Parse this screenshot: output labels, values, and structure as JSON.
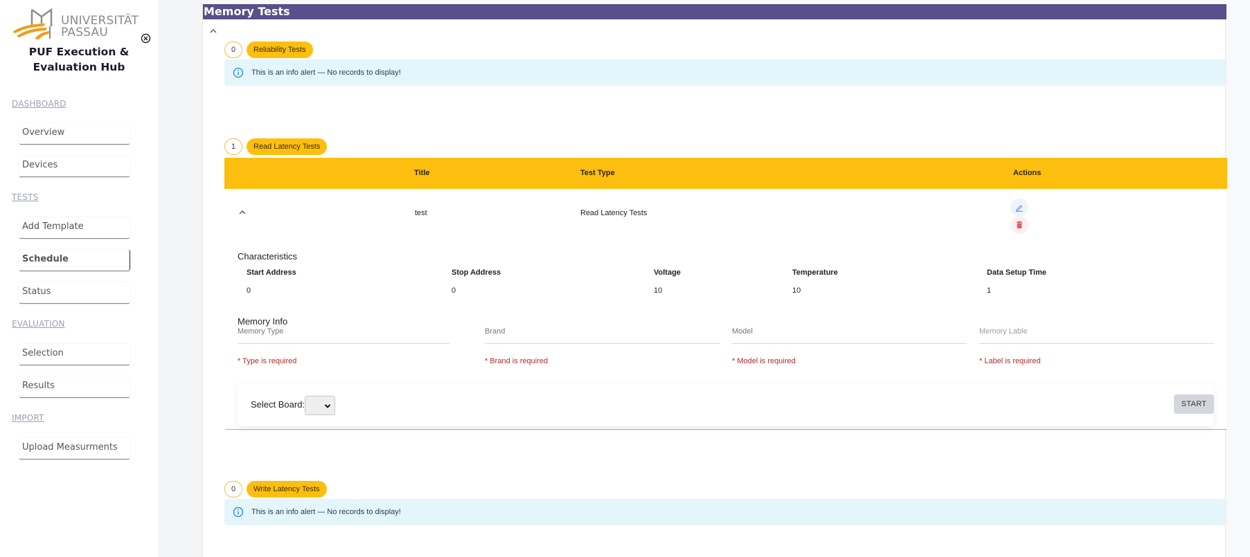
{
  "sidebar": {
    "logo": {
      "line1": "UNIVERSITÄT",
      "line2": "PASSAU"
    },
    "app_title": "PUF Execution & Evaluation Hub",
    "sections": [
      {
        "label": "DASHBOARD",
        "items": [
          {
            "label": "Overview"
          },
          {
            "label": "Devices"
          }
        ]
      },
      {
        "label": "TESTS",
        "items": [
          {
            "label": "Add Template"
          },
          {
            "label": "Schedule",
            "active": true
          },
          {
            "label": "Status"
          }
        ]
      },
      {
        "label": "EVALUATION",
        "items": [
          {
            "label": "Selection"
          },
          {
            "label": "Results"
          }
        ]
      },
      {
        "label": "IMPORT",
        "items": [
          {
            "label": "Upload Measurments"
          }
        ]
      }
    ]
  },
  "main": {
    "title": "Memory Tests",
    "groups": [
      {
        "count": "0",
        "label": "Reliability Tests",
        "alert": "This is an info alert — No records to display!"
      },
      {
        "count": "1",
        "label": "Read Latency Tests"
      },
      {
        "count": "0",
        "label": "Write Latency Tests",
        "alert": "This is an info alert — No records to display!"
      }
    ],
    "table": {
      "columns": [
        "Title",
        "Test Type",
        "Actions"
      ],
      "rows": [
        {
          "title": "test",
          "test_type": "Read Latency Tests",
          "characteristics_title": "Characteristics",
          "characteristics": [
            {
              "label": "Start Address",
              "value": "0"
            },
            {
              "label": "Stop Address",
              "value": "0"
            },
            {
              "label": "Voltage",
              "value": "10"
            },
            {
              "label": "Temperature",
              "value": "10"
            },
            {
              "label": "Data Setup Time",
              "value": "1"
            }
          ],
          "memory_info_title": "Memory Info",
          "memory_fields": [
            {
              "placeholder": "Memory Type",
              "error": "* Type is required"
            },
            {
              "placeholder": "Brand",
              "error": "* Brand is required"
            },
            {
              "placeholder": "Model",
              "error": "* Model is required"
            },
            {
              "placeholder": "Memory Lable",
              "error": "* Label is required"
            }
          ],
          "select_board_label": "Select Board:",
          "select_board_value": "",
          "start_label": "START"
        }
      ]
    }
  },
  "colors": {
    "header": "#594f8a",
    "accent": "#fdbf0f",
    "alert_bg": "#e5f5fc",
    "error": "#b02a2a",
    "logo_orange": "#f39a1a"
  }
}
